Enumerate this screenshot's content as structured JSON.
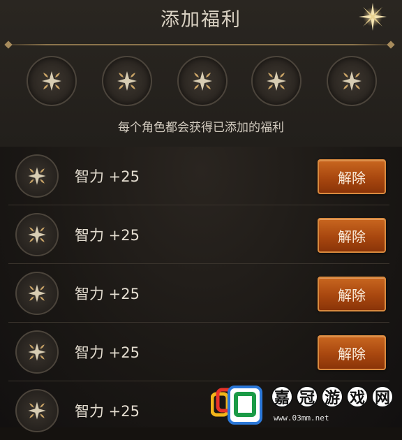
{
  "dialog": {
    "title": "添加福利",
    "subtitle": "每个角色都会获得已添加的福利",
    "close_icon": "sparkle-close-icon"
  },
  "slots": [
    {
      "icon": "benefit-emblem-icon"
    },
    {
      "icon": "benefit-emblem-icon"
    },
    {
      "icon": "benefit-emblem-icon"
    },
    {
      "icon": "benefit-emblem-icon"
    },
    {
      "icon": "benefit-emblem-icon"
    }
  ],
  "benefits": [
    {
      "label": "智力 +25",
      "button": "解除"
    },
    {
      "label": "智力 +25",
      "button": "解除"
    },
    {
      "label": "智力 +25",
      "button": "解除"
    },
    {
      "label": "智力 +25",
      "button": "解除"
    },
    {
      "label": "智力 +25",
      "button": ""
    }
  ],
  "watermark": {
    "chars": [
      "嘉",
      "冠",
      "游",
      "戏",
      "网"
    ],
    "url": "www.03mm.net"
  },
  "colors": {
    "accent_orange": "#c8661f",
    "gold": "#a78b5c",
    "text": "#e4ddd0"
  }
}
